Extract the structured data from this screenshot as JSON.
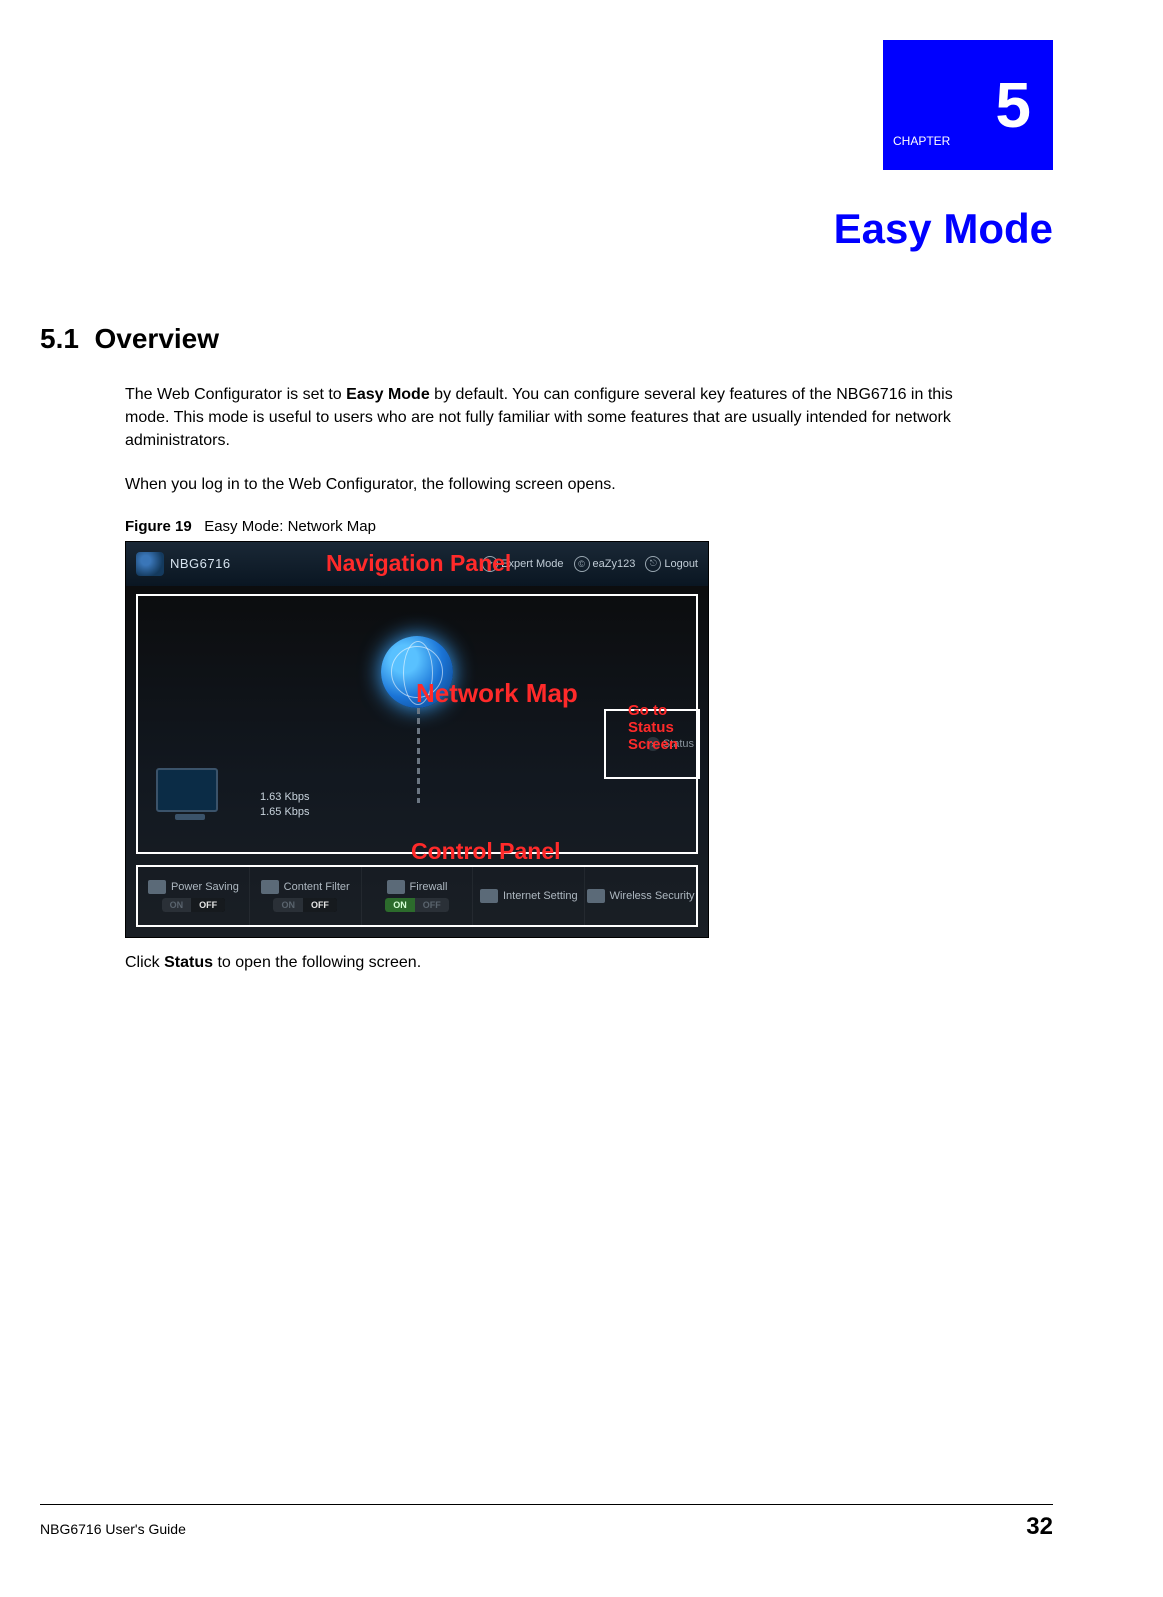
{
  "chapter": {
    "label_prefix": "CHAPTER",
    "number": "5",
    "title": "Easy Mode"
  },
  "section": {
    "number": "5.1",
    "title": "Overview"
  },
  "paragraphs": {
    "p1_a": "The Web Configurator is set to ",
    "p1_bold": "Easy Mode",
    "p1_b": " by default. You can configure several key features of the NBG6716 in this mode. This mode is useful to users who are not fully familiar with some features that are usually intended for network administrators.",
    "p2": "When you log in to the Web Configurator, the following screen opens."
  },
  "figure_caption": {
    "label": "Figure 19",
    "text": "Easy Mode: Network Map"
  },
  "figure": {
    "brand": "NBG6716",
    "nav": {
      "expert": "Expert Mode",
      "user": "eaZy123",
      "logout": "Logout"
    },
    "annotations": {
      "navigation": "Navigation Panel",
      "network_map": "Network Map",
      "go_to": "Go to",
      "status_screen_l1": "Status",
      "status_screen_l2": "Screen",
      "control_panel": "Control Panel"
    },
    "status_button": "Status",
    "kbps": {
      "up": "1.63 Kbps",
      "down": "1.65 Kbps"
    },
    "control_items": [
      {
        "label": "Power Saving",
        "on": "ON",
        "off": "OFF",
        "state": "off"
      },
      {
        "label": "Content Filter",
        "on": "ON",
        "off": "OFF",
        "state": "off"
      },
      {
        "label": "Firewall",
        "on": "ON",
        "off": "OFF",
        "state": "on"
      },
      {
        "label": "Internet Setting",
        "on": "",
        "off": "",
        "state": "none"
      },
      {
        "label": "Wireless Security",
        "on": "",
        "off": "",
        "state": "none"
      }
    ]
  },
  "post_figure_a": "Click ",
  "post_figure_bold": "Status",
  "post_figure_b": " to open the following screen.",
  "footer": {
    "guide": "NBG6716 User's Guide",
    "page": "32"
  }
}
